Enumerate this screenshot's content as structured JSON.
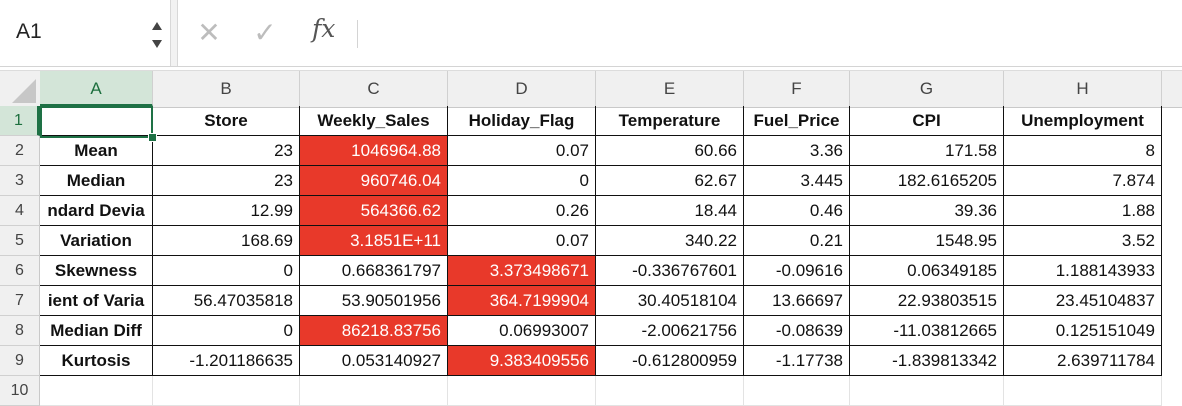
{
  "formula_bar": {
    "name_box": "A1",
    "cancel_icon": "✕",
    "confirm_icon": "✓",
    "fx_label": "fx",
    "formula": ""
  },
  "columns": [
    "A",
    "B",
    "C",
    "D",
    "E",
    "F",
    "G",
    "H"
  ],
  "rows": [
    "1",
    "2",
    "3",
    "4",
    "5",
    "6",
    "7",
    "8",
    "9",
    "10"
  ],
  "grid": [
    [
      "",
      "Store",
      "Weekly_Sales",
      "Holiday_Flag",
      "Temperature",
      "Fuel_Price",
      "CPI",
      "Unemployment"
    ],
    [
      "Mean",
      "23",
      "1046964.88",
      "0.07",
      "60.66",
      "3.36",
      "171.58",
      "8"
    ],
    [
      "Median",
      "23",
      "960746.04",
      "0",
      "62.67",
      "3.445",
      "182.6165205",
      "7.874"
    ],
    [
      "ndard Devia",
      "12.99",
      "564366.62",
      "0.26",
      "18.44",
      "0.46",
      "39.36",
      "1.88"
    ],
    [
      "Variation",
      "168.69",
      "3.1851E+11",
      "0.07",
      "340.22",
      "0.21",
      "1548.95",
      "3.52"
    ],
    [
      "Skewness",
      "0",
      "0.668361797",
      "3.373498671",
      "-0.336767601",
      "-0.09616",
      "0.06349185",
      "1.188143933"
    ],
    [
      "ient of Varia",
      "56.47035818",
      "53.90501956",
      "364.7199904",
      "30.40518104",
      "13.66697",
      "22.93803515",
      "23.45104837"
    ],
    [
      "Median Diff",
      "0",
      "86218.83756",
      "0.06993007",
      "-2.00621756",
      "-0.08639",
      "-11.03812665",
      "0.125151049"
    ],
    [
      "Kurtosis",
      "-1.201186635",
      "0.053140927",
      "9.383409556",
      "-0.612800959",
      "-1.17738",
      "-1.839813342",
      "2.639711784"
    ]
  ],
  "highlight_color": "#e8392a",
  "highlighted_cells": [
    "C2",
    "C3",
    "C4",
    "C5",
    "D6",
    "D7",
    "C8",
    "D9"
  ],
  "active_cell": "A1"
}
